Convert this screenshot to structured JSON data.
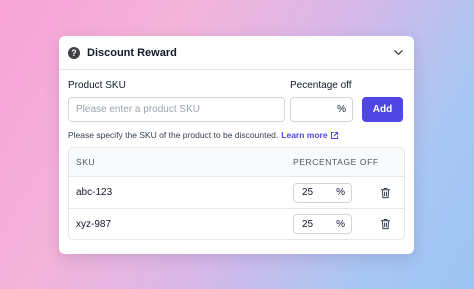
{
  "card": {
    "title": "Discount Reward",
    "help_icon": "question-circle-icon",
    "collapse_icon": "chevron-down-icon"
  },
  "form": {
    "sku_label": "Product SKU",
    "pct_label": "Pecentage off",
    "sku_placeholder": "Please enter a product SKU",
    "pct_suffix": "%",
    "add_label": "Add"
  },
  "hint": {
    "text": "Please specify the SKU of the product to be discounted.",
    "link": "Learn more",
    "link_icon": "external-link-icon"
  },
  "table": {
    "headers": {
      "sku": "SKU",
      "pct": "PERCENTAGE OFF"
    },
    "rows": [
      {
        "sku": "abc-123",
        "pct": "25",
        "suffix": "%"
      },
      {
        "sku": "xyz-987",
        "pct": "25",
        "suffix": "%"
      }
    ]
  },
  "colors": {
    "accent": "#4f46e5"
  }
}
